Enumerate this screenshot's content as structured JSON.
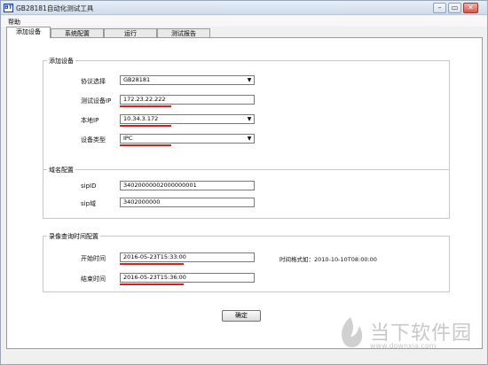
{
  "window": {
    "title": "GB28181自动化测试工具",
    "icon_text": "BT",
    "controls": {
      "minimize": "–",
      "maximize": "▭",
      "close": "✕"
    }
  },
  "menu": {
    "help": "帮助"
  },
  "tabs": [
    "添加设备",
    "系统配置",
    "运行",
    "测试报告"
  ],
  "add_device": {
    "title": "添加设备",
    "protocol_label": "协议选择",
    "protocol_value": "GB28181",
    "device_ip_label": "测试设备IP",
    "device_ip_value": "172.23.22.222",
    "local_ip_label": "本地IP",
    "local_ip_value": "10.34.3.172",
    "device_type_label": "设备类型",
    "device_type_value": "IPC"
  },
  "domain": {
    "title": "域名配置",
    "sip_id_label": "sipID",
    "sip_id_value": "34020000002000000001",
    "sip_domain_label": "sip域",
    "sip_domain_value": "3402000000"
  },
  "record_query": {
    "title": "录像查询时间配置",
    "start_label": "开始时间",
    "start_value": "2016-05-23T15:33:00",
    "end_label": "结束时间",
    "end_value": "2016-05-23T15:36:00",
    "format_hint": "时间格式如：2010-10-10T08:00:00"
  },
  "ok_button": "确定",
  "watermark": {
    "name": "当下软件园",
    "url": "www.downxia.com"
  },
  "colors": {
    "underline": "#d62020"
  }
}
